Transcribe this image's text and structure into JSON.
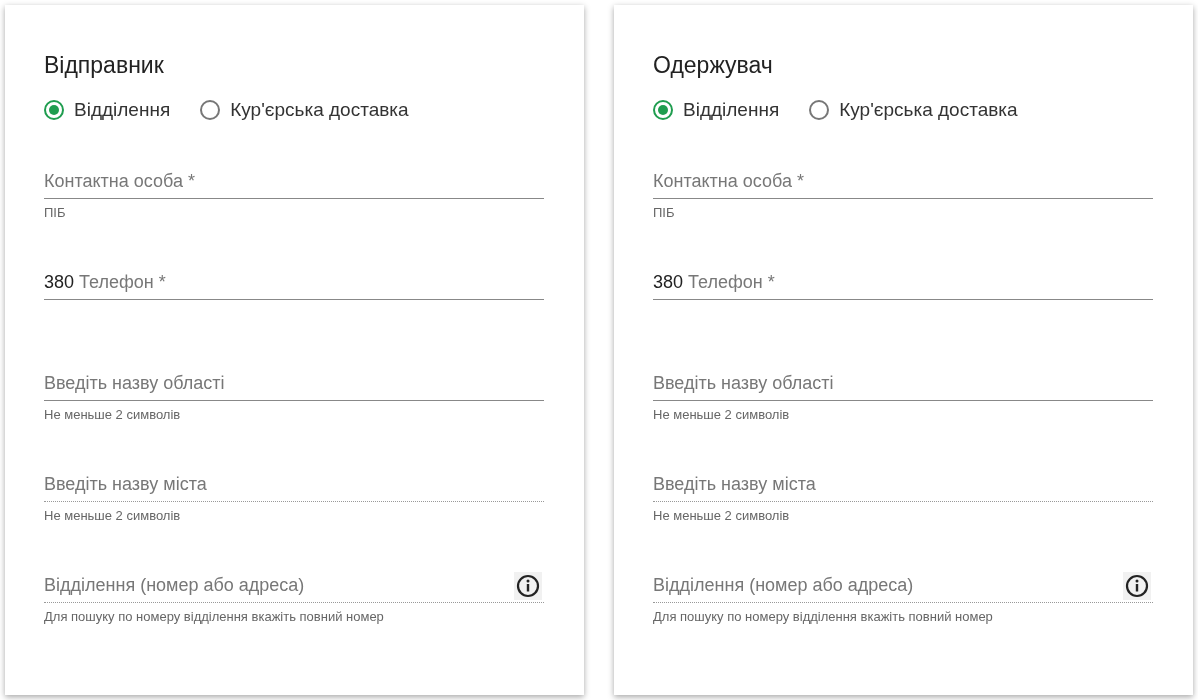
{
  "panels": [
    {
      "title": "Відправник",
      "delivery_options": [
        {
          "label": "Відділення",
          "selected": true
        },
        {
          "label": "Кур'єрська доставка",
          "selected": false
        }
      ],
      "fields": [
        {
          "placeholder": "Контактна особа *",
          "hint": "ПІБ",
          "disabled": false
        },
        {
          "prefix": "380",
          "placeholder": "Телефон *",
          "disabled": false
        },
        {
          "placeholder": "Введіть назву області",
          "hint": "Не меньше 2 символів",
          "disabled": false
        },
        {
          "placeholder": "Введіть назву міста",
          "hint": "Не меньше 2 символів",
          "disabled": true
        },
        {
          "placeholder": "Відділення (номер або адреса)",
          "hint": "Для пошуку по номеру відділення вкажіть повний номер",
          "disabled": true,
          "info": true
        }
      ]
    },
    {
      "title": "Одержувач",
      "delivery_options": [
        {
          "label": "Відділення",
          "selected": true
        },
        {
          "label": "Кур'єрська доставка",
          "selected": false
        }
      ],
      "fields": [
        {
          "placeholder": "Контактна особа *",
          "hint": "ПІБ",
          "disabled": false
        },
        {
          "prefix": "380",
          "placeholder": "Телефон *",
          "disabled": false
        },
        {
          "placeholder": "Введіть назву області",
          "hint": "Не меньше 2 символів",
          "disabled": false
        },
        {
          "placeholder": "Введіть назву міста",
          "hint": "Не меньше 2 символів",
          "disabled": true
        },
        {
          "placeholder": "Відділення (номер або адреса)",
          "hint": "Для пошуку по номеру відділення вкажіть повний номер",
          "disabled": true,
          "info": true
        }
      ]
    }
  ]
}
